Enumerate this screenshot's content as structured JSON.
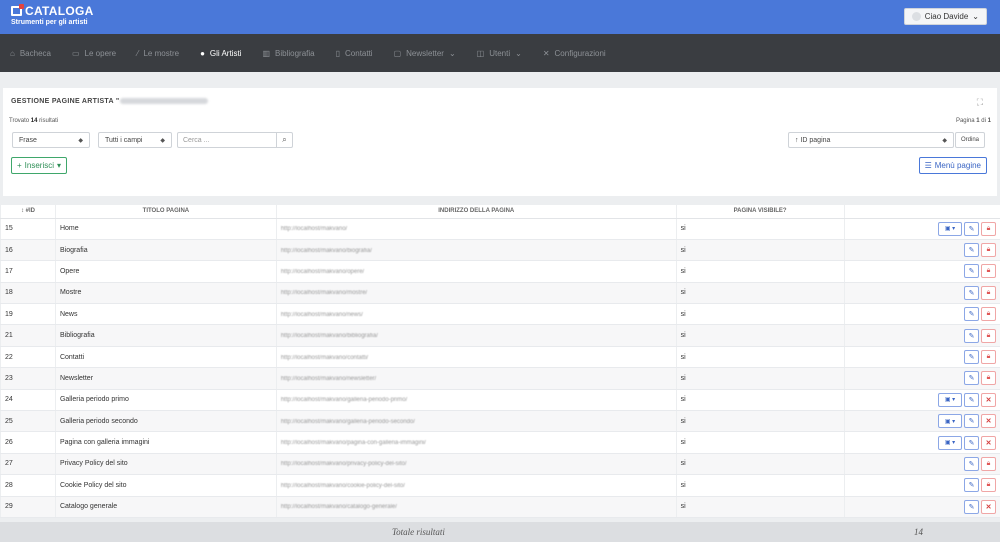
{
  "brand": {
    "title": "CATALOGA",
    "subtitle": "Strumenti per gli artisti"
  },
  "user": {
    "greeting": "Ciao Davide"
  },
  "nav": [
    {
      "label": "Bacheca",
      "icon": "home-icon",
      "active": false,
      "dropdown": false
    },
    {
      "label": "Le opere",
      "icon": "image-icon",
      "active": false,
      "dropdown": false
    },
    {
      "label": "Le mostre",
      "icon": "brush-icon",
      "active": false,
      "dropdown": false
    },
    {
      "label": "Gli Artisti",
      "icon": "palette-icon",
      "active": true,
      "dropdown": false
    },
    {
      "label": "Bibliografia",
      "icon": "books-icon",
      "active": false,
      "dropdown": false
    },
    {
      "label": "Contatti",
      "icon": "addressbook-icon",
      "active": false,
      "dropdown": false
    },
    {
      "label": "Newsletter",
      "icon": "inbox-icon",
      "active": false,
      "dropdown": true
    },
    {
      "label": "Utenti",
      "icon": "users-icon",
      "active": false,
      "dropdown": true
    },
    {
      "label": "Configurazioni",
      "icon": "tools-icon",
      "active": false,
      "dropdown": false
    }
  ],
  "panel": {
    "title": "GESTIONE PAGINE ARTISTA \"",
    "found_prefix": "Trovato ",
    "found_count": "14",
    "found_suffix": " risultati",
    "page_prefix": "Pagina ",
    "page_current": "1",
    "page_mid": " di ",
    "page_total": "1",
    "filter_mode": "Frase",
    "filter_fields": "Tutti i campi",
    "search_placeholder": "Cerca ...",
    "sort_field": "↑ ID pagina",
    "order_label": "Ordina",
    "insert_label": "Inserisci",
    "menu_label": "Menù pagine"
  },
  "table": {
    "headers": [
      "↕ #ID",
      "TITOLO PAGINA",
      "INDIRIZZO DELLA PAGINA",
      "PAGINA VISIBILE?",
      ""
    ],
    "rows": [
      {
        "id": "15",
        "title": "Home",
        "url": "http://localhost/makvano/",
        "visible": "si",
        "actions": "gallery-lock"
      },
      {
        "id": "16",
        "title": "Biografia",
        "url": "http://localhost/makvano/biografia/",
        "visible": "si",
        "actions": "lock"
      },
      {
        "id": "17",
        "title": "Opere",
        "url": "http://localhost/makvano/opere/",
        "visible": "si",
        "actions": "lock"
      },
      {
        "id": "18",
        "title": "Mostre",
        "url": "http://localhost/makvano/mostre/",
        "visible": "si",
        "actions": "lock"
      },
      {
        "id": "19",
        "title": "News",
        "url": "http://localhost/makvano/news/",
        "visible": "si",
        "actions": "lock"
      },
      {
        "id": "21",
        "title": "Bibliografia",
        "url": "http://localhost/makvano/bibliografia/",
        "visible": "si",
        "actions": "lock"
      },
      {
        "id": "22",
        "title": "Contatti",
        "url": "http://localhost/makvano/contatti/",
        "visible": "si",
        "actions": "lock"
      },
      {
        "id": "23",
        "title": "Newsletter",
        "url": "http://localhost/makvano/newsletter/",
        "visible": "si",
        "actions": "lock"
      },
      {
        "id": "24",
        "title": "Galleria periodo primo",
        "url": "http://localhost/makvano/galleria-periodo-primo/",
        "visible": "si",
        "actions": "gallery-delete"
      },
      {
        "id": "25",
        "title": "Galleria periodo secondo",
        "url": "http://localhost/makvano/galleria-periodo-secondo/",
        "visible": "si",
        "actions": "gallery-delete"
      },
      {
        "id": "26",
        "title": "Pagina con galleria immagini",
        "url": "http://localhost/makvano/pagina-con-galleria-immagini/",
        "visible": "si",
        "actions": "gallery-delete"
      },
      {
        "id": "27",
        "title": "Privacy Policy del sito",
        "url": "http://localhost/makvano/privacy-policy-del-sito/",
        "visible": "si",
        "actions": "lock"
      },
      {
        "id": "28",
        "title": "Cookie Policy del sito",
        "url": "http://localhost/makvano/cookie-policy-del-sito/",
        "visible": "si",
        "actions": "lock"
      },
      {
        "id": "29",
        "title": "Catalogo generale",
        "url": "http://localhost/makvano/catalogo-generale/",
        "visible": "si",
        "actions": "delete"
      }
    ]
  },
  "footer": {
    "total_label": "Totale risultati",
    "total_value": "14"
  },
  "colors": {
    "topbar": "#4a78d9",
    "navbar": "#3a3d41",
    "insert": "#3fa76b",
    "danger": "#e05757"
  }
}
